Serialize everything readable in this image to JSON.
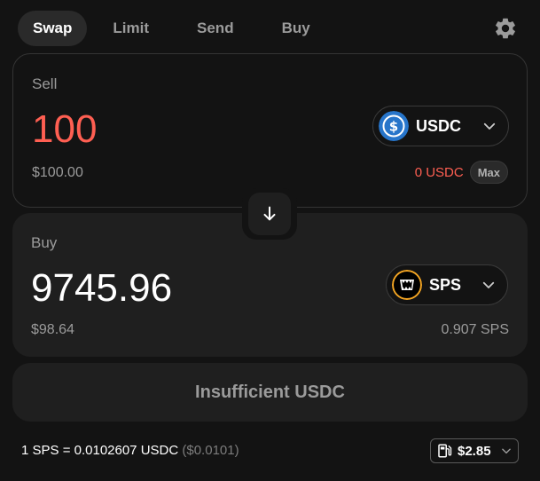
{
  "tabs": [
    {
      "label": "Swap",
      "active": true
    },
    {
      "label": "Limit",
      "active": false
    },
    {
      "label": "Send",
      "active": false
    },
    {
      "label": "Buy",
      "active": false
    }
  ],
  "icons": {
    "settings": "gear-icon",
    "flip": "arrow-down-icon",
    "chevron": "chevron-down-icon",
    "gas": "fuel-pump-icon"
  },
  "sell": {
    "label": "Sell",
    "amount": "100",
    "usd_value": "$100.00",
    "token": "USDC",
    "token_color": "#2775ca",
    "balance_warning": "0 USDC",
    "max_label": "Max"
  },
  "buy": {
    "label": "Buy",
    "amount": "9745.96",
    "usd_value": "$98.64",
    "token": "SPS",
    "token_ring_color": "#f5a623",
    "balance": "0.907 SPS"
  },
  "action": {
    "label": "Insufficient USDC"
  },
  "footer": {
    "rate": "1 SPS = 0.0102607 USDC",
    "rate_usd": "($0.0101)",
    "gas_value": "$2.85"
  },
  "colors": {
    "background": "#131313",
    "card": "#1f1f1f",
    "error": "#ff5f52",
    "muted": "#9b9b9b"
  }
}
